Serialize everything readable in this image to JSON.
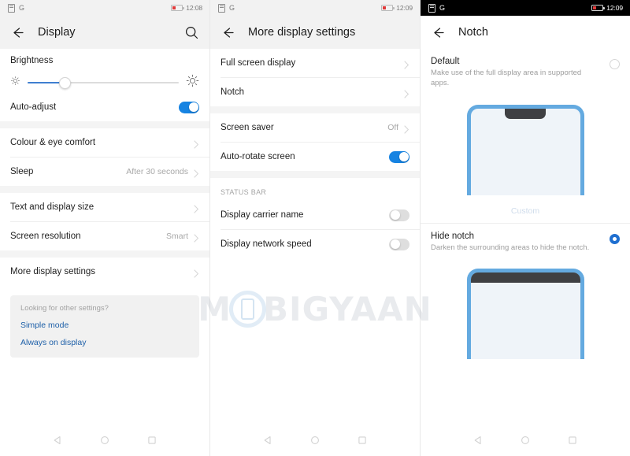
{
  "panels": [
    {
      "status": {
        "doc_icon": "document-icon",
        "g_icon": "G",
        "battery": "battery-low-icon",
        "clock": "12:08",
        "theme": "light"
      },
      "appbar": {
        "back": "back-arrow-icon",
        "title": "Display",
        "search": "search-icon"
      },
      "brightness": {
        "title": "Brightness",
        "low_icon": "brightness-low-icon",
        "high_icon": "brightness-high-icon",
        "level_percent": 24
      },
      "auto_adjust": {
        "label": "Auto-adjust",
        "toggle": "on"
      },
      "rows": [
        {
          "label": "Colour & eye comfort",
          "value": "",
          "chevron": true
        },
        {
          "label": "Sleep",
          "value": "After 30 seconds",
          "chevron": true
        },
        {
          "label": "Text and display size",
          "value": "",
          "chevron": true
        },
        {
          "label": "Screen resolution",
          "value": "Smart",
          "chevron": true
        },
        {
          "label": "More display settings",
          "value": "",
          "chevron": true
        }
      ],
      "info_card": {
        "question": "Looking for other settings?",
        "links": [
          "Simple mode",
          "Always on display"
        ]
      }
    },
    {
      "status": {
        "doc_icon": "document-icon",
        "g_icon": "G",
        "battery": "battery-low-icon",
        "clock": "12:09",
        "theme": "light"
      },
      "appbar": {
        "back": "back-arrow-icon",
        "title": "More display settings"
      },
      "rows": [
        {
          "label": "Full screen display",
          "value": "",
          "chevron": true
        },
        {
          "label": "Notch",
          "value": "",
          "chevron": true
        }
      ],
      "rows2": [
        {
          "label": "Screen saver",
          "value": "Off",
          "chevron": true
        }
      ],
      "auto_rotate": {
        "label": "Auto-rotate screen",
        "toggle": "on"
      },
      "section_caption": "STATUS BAR",
      "toggles": [
        {
          "label": "Display carrier name",
          "toggle": "off"
        },
        {
          "label": "Display network speed",
          "toggle": "off"
        }
      ]
    },
    {
      "status": {
        "doc_icon": "document-icon",
        "g_icon": "G",
        "battery": "battery-low-icon",
        "clock": "12:09",
        "theme": "dark"
      },
      "appbar": {
        "back": "back-arrow-icon",
        "title": "Notch"
      },
      "options": [
        {
          "title": "Default",
          "subtitle": "Make use of the full display area in supported apps.",
          "selected": false,
          "preview": "notch-visible",
          "preview_label": "Custom"
        },
        {
          "title": "Hide notch",
          "subtitle": "Darken the surrounding areas to hide the notch.",
          "selected": true,
          "preview": "notch-hidden",
          "preview_label": ""
        }
      ]
    }
  ],
  "navbar": {
    "back": "nav-back-triangle-icon",
    "home": "nav-home-circle-icon",
    "recents": "nav-recents-square-icon"
  },
  "watermark": {
    "part1": "M",
    "part2": "BIGYAAN",
    "phone_glyph": "phone-icon"
  },
  "colors": {
    "accent_blue": "#1683e2",
    "link_blue": "#1d5fa8",
    "radio_blue": "#1f6fd0",
    "frame_blue": "#64aae0",
    "notch_dark": "#3f4043",
    "battery_red": "#e03b3b"
  }
}
